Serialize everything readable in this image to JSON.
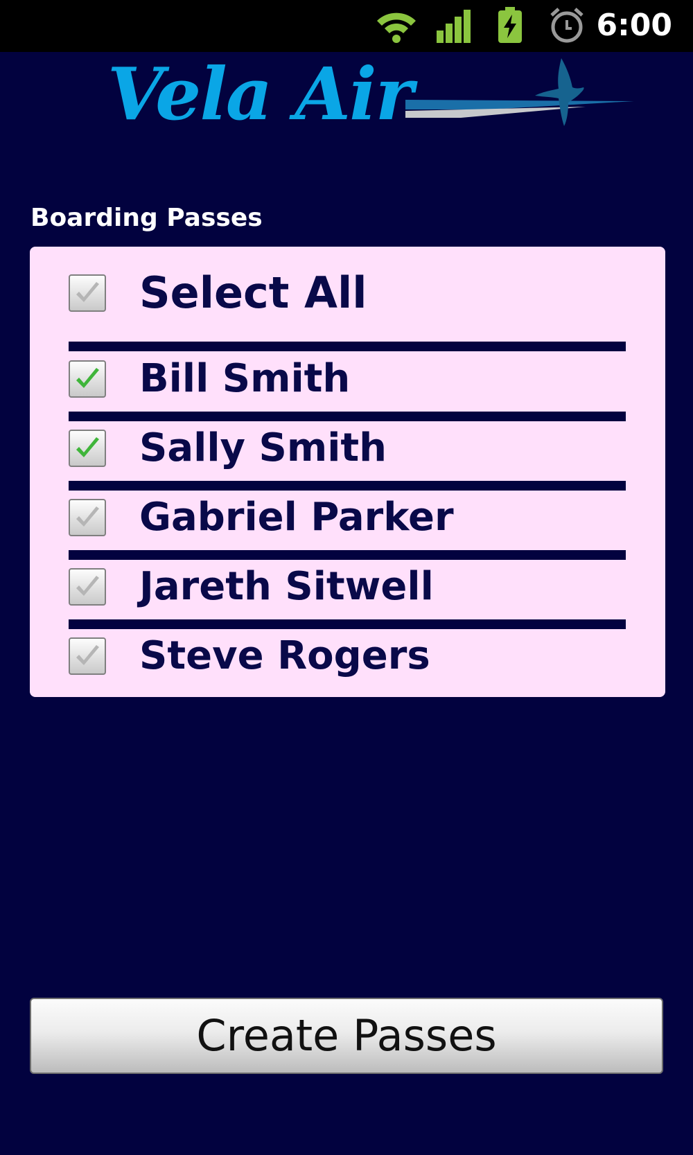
{
  "status_bar": {
    "icons": [
      "wifi-icon",
      "signal-icon",
      "battery-charging-icon",
      "alarm-icon"
    ],
    "time": "6:00"
  },
  "logo": {
    "text": "Vela Air",
    "icon": "bird-icon",
    "brand_color": "#0aa6e6"
  },
  "section": {
    "title": "Boarding Passes"
  },
  "passes": {
    "select_all": {
      "label": "Select All",
      "checked": false
    },
    "passengers": [
      {
        "name": "Bill Smith",
        "checked": true
      },
      {
        "name": "Sally Smith",
        "checked": true
      },
      {
        "name": "Gabriel Parker",
        "checked": false
      },
      {
        "name": "Jareth Sitwell",
        "checked": false
      },
      {
        "name": "Steve Rogers",
        "checked": false
      }
    ]
  },
  "actions": {
    "create_label": "Create Passes"
  },
  "colors": {
    "background": "#02023f",
    "panel": "#ffe0fb",
    "text": "#090949",
    "check_on": "#3fb53a",
    "check_off": "#b5b5b5"
  }
}
